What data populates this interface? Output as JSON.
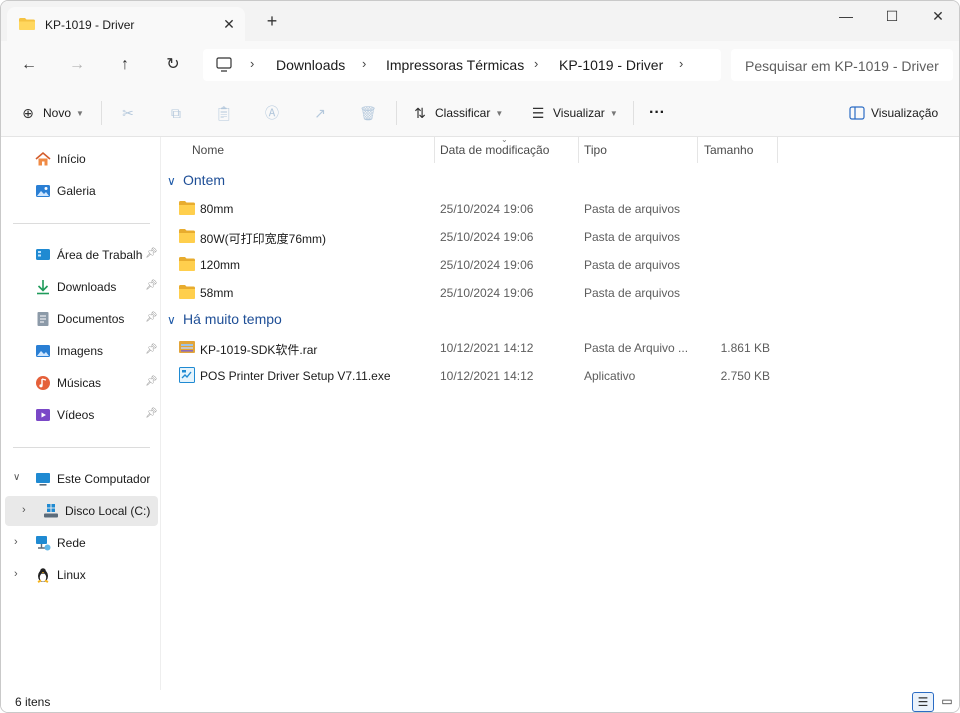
{
  "window": {
    "tab_title": "KP-1019 - Driver",
    "close_tab_glyph": "✕",
    "new_tab_glyph": "+",
    "minimize_glyph": "—",
    "maximize_glyph": "☐",
    "close_glyph": "✕"
  },
  "nav": {
    "back_glyph": "←",
    "forward_glyph": "→",
    "up_glyph": "↑",
    "refresh_glyph": "↻",
    "breadcrumbs": [
      "Downloads",
      "Impressoras Térmicas",
      "KP-1019 - Driver"
    ],
    "search_placeholder": "Pesquisar em KP-1019 - Driver"
  },
  "toolbar": {
    "new_label": "Novo",
    "sort_label": "Classificar",
    "view_label": "Visualizar",
    "more_glyph": "···",
    "preview_label": "Visualização",
    "icons": [
      "cut-icon",
      "copy-icon",
      "paste-icon",
      "rename-icon",
      "share-icon",
      "delete-icon"
    ]
  },
  "sidebar": {
    "quick": [
      {
        "label": "Início",
        "icon": "home-icon"
      },
      {
        "label": "Galeria",
        "icon": "gallery-icon"
      }
    ],
    "pinned": [
      {
        "label": "Área de Trabalho",
        "icon": "desktop-icon"
      },
      {
        "label": "Downloads",
        "icon": "downloads-icon"
      },
      {
        "label": "Documentos",
        "icon": "documents-icon"
      },
      {
        "label": "Imagens",
        "icon": "pictures-icon"
      },
      {
        "label": "Músicas",
        "icon": "music-icon"
      },
      {
        "label": "Vídeos",
        "icon": "videos-icon"
      }
    ],
    "drives": [
      {
        "label": "Este Computador",
        "icon": "computer-icon"
      },
      {
        "label": "Disco Local (C:)",
        "icon": "drive-icon"
      },
      {
        "label": "Rede",
        "icon": "network-icon"
      },
      {
        "label": "Linux",
        "icon": "linux-icon"
      }
    ]
  },
  "columns": {
    "name": "Nome",
    "date": "Data de modificação",
    "type": "Tipo",
    "size": "Tamanho"
  },
  "groups": [
    {
      "title": "Ontem",
      "items": [
        {
          "name": "80mm",
          "date": "25/10/2024 19:06",
          "type": "Pasta de arquivos",
          "size": "",
          "icon": "folder-icon"
        },
        {
          "name": "80W(可打印宽度76mm)",
          "date": "25/10/2024 19:06",
          "type": "Pasta de arquivos",
          "size": "",
          "icon": "folder-icon"
        },
        {
          "name": "120mm",
          "date": "25/10/2024 19:06",
          "type": "Pasta de arquivos",
          "size": "",
          "icon": "folder-icon"
        },
        {
          "name": "58mm",
          "date": "25/10/2024 19:06",
          "type": "Pasta de arquivos",
          "size": "",
          "icon": "folder-icon"
        }
      ]
    },
    {
      "title": "Há muito tempo",
      "items": [
        {
          "name": "KP-1019-SDK软件.rar",
          "date": "10/12/2021 14:12",
          "type": "Pasta de Arquivo ...",
          "size": "1.861 KB",
          "icon": "archive-icon"
        },
        {
          "name": "POS Printer Driver Setup V7.11.exe",
          "date": "10/12/2021 14:12",
          "type": "Aplicativo",
          "size": "2.750 KB",
          "icon": "installer-icon"
        }
      ]
    }
  ],
  "status": {
    "item_count": "6 itens"
  },
  "colors": {
    "accent": "#1e4e96",
    "folder": "#f5c342",
    "selected_bg": "#e9e9e9"
  }
}
